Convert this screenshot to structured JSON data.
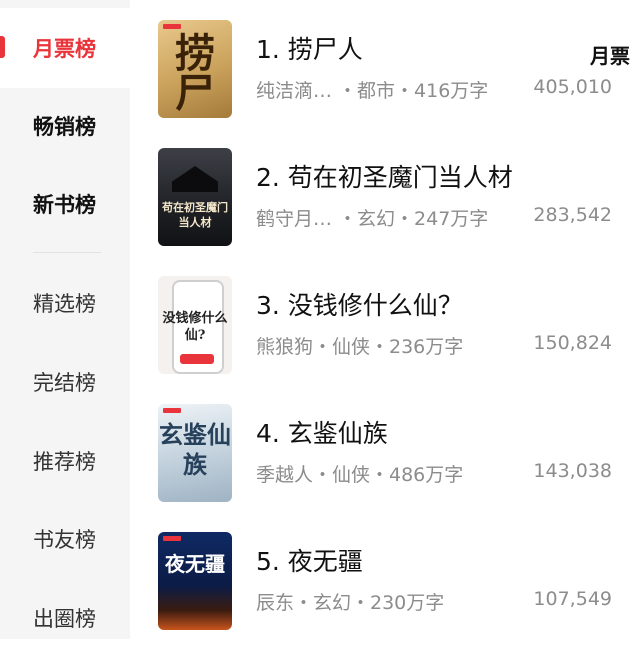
{
  "sidebar": {
    "items": [
      {
        "label": "月票榜"
      },
      {
        "label": "畅销榜"
      },
      {
        "label": "新书榜"
      },
      {
        "label": "精选榜"
      },
      {
        "label": "完结榜"
      },
      {
        "label": "推荐榜"
      },
      {
        "label": "书友榜"
      },
      {
        "label": "出圈榜"
      }
    ]
  },
  "list": {
    "metric_label": "月票",
    "books": [
      {
        "title": "1. 捞尸人",
        "meta": "纯洁滴… ・都市・416万字",
        "count": "405,010",
        "cover_text": "捞尸"
      },
      {
        "title": "2. 苟在初圣魔门当人材",
        "meta": "鹤守月… ・玄幻・247万字",
        "count": "283,542",
        "cover_text": "苟在初圣魔门当人材"
      },
      {
        "title": "3. 没钱修什么仙？",
        "meta": "熊狼狗・仙侠・236万字",
        "count": "150,824",
        "cover_text": "没钱修什么仙?"
      },
      {
        "title": "4. 玄鉴仙族",
        "meta": "季越人・仙侠・486万字",
        "count": "143,038",
        "cover_text": "玄鉴仙族"
      },
      {
        "title": "5. 夜无疆",
        "meta": "辰东・玄幻・230万字",
        "count": "107,549",
        "cover_text": "夜无疆"
      }
    ]
  },
  "colors": {
    "accent": "#e8343a",
    "sidebar_bg": "#f5f5f5"
  }
}
